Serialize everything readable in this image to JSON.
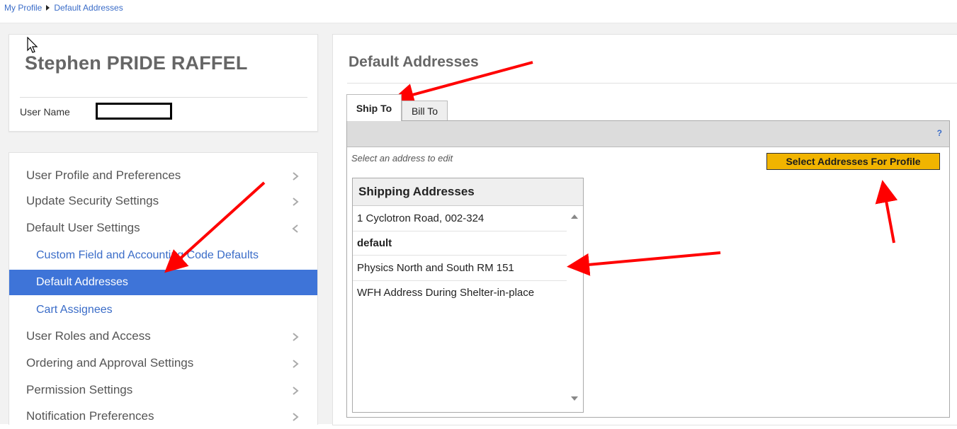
{
  "breadcrumb": {
    "items": [
      "My Profile",
      "Default Addresses"
    ]
  },
  "user": {
    "full_name": "Stephen PRIDE RAFFEL",
    "username_label": "User Name",
    "username_value": ""
  },
  "nav": {
    "items": [
      {
        "label": "User Profile and Preferences",
        "chevron": "right"
      },
      {
        "label": "Update Security Settings",
        "chevron": "right"
      },
      {
        "label": "Default User Settings",
        "chevron": "left"
      },
      {
        "label": "Custom Field and Accounting Code Defaults",
        "sub": true
      },
      {
        "label": "Default Addresses",
        "sub": true,
        "active": true
      },
      {
        "label": "Cart Assignees",
        "sub": true
      },
      {
        "label": "User Roles and Access",
        "chevron": "right"
      },
      {
        "label": "Ordering and Approval Settings",
        "chevron": "right"
      },
      {
        "label": "Permission Settings",
        "chevron": "right"
      },
      {
        "label": "Notification Preferences",
        "chevron": "right"
      }
    ]
  },
  "main": {
    "title": "Default Addresses",
    "tabs": [
      {
        "label": "Ship To",
        "active": true
      },
      {
        "label": "Bill To",
        "active": false
      }
    ],
    "help_label": "?",
    "hint": "Select an address to edit",
    "select_button": "Select Addresses For Profile",
    "address_list": {
      "header": "Shipping Addresses",
      "items": [
        {
          "label": "1 Cyclotron Road, 002-324",
          "bold": false
        },
        {
          "label": "default",
          "bold": true
        },
        {
          "label": "Physics North and South RM 151",
          "bold": false
        },
        {
          "label": "WFH Address During Shelter-in-place",
          "bold": false
        }
      ]
    }
  },
  "colors": {
    "accent_blue": "#3e74d8",
    "link_blue": "#3a6cc8",
    "button_yellow": "#f1b400",
    "annotation_red": "#ff0000"
  },
  "icons": {
    "breadcrumb_separator": "triangle-right-icon",
    "nav_chevron_right": "chevron-right-icon",
    "nav_chevron_left": "chevron-left-icon",
    "cursor": "mouse-pointer-icon"
  }
}
